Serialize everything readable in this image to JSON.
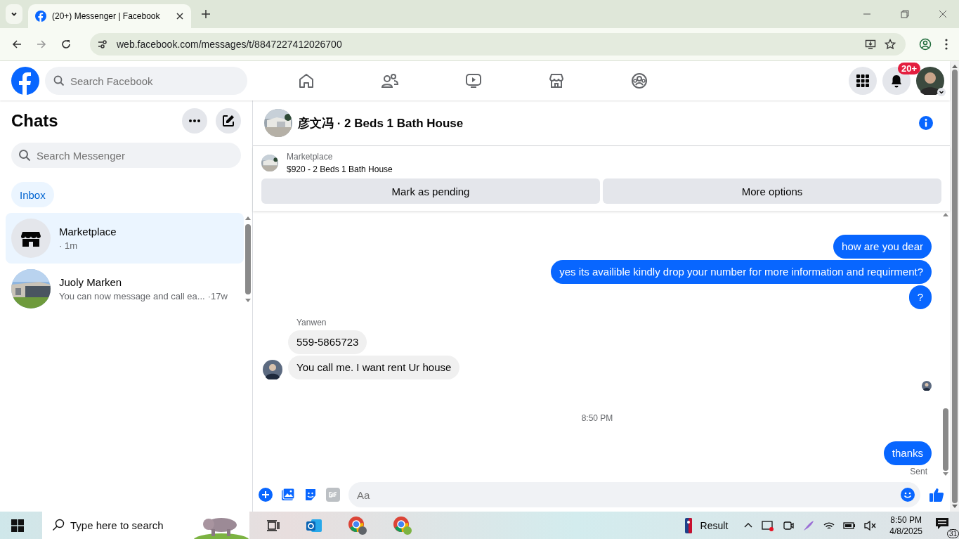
{
  "browser": {
    "tabs": [
      {
        "title": "(20+) Messenger | Facebook",
        "selected": true
      }
    ],
    "url": "web.facebook.com/messages/t/8847227412026700"
  },
  "topbar": {
    "search_placeholder": "Search Facebook",
    "notification_badge": "20+"
  },
  "sidebar": {
    "title": "Chats",
    "search_placeholder": "Search Messenger",
    "filters": [
      {
        "label": "Inbox",
        "selected": true
      }
    ],
    "chats": [
      {
        "kind": "store",
        "name": "Marketplace",
        "time": "· 1m",
        "selected": true
      },
      {
        "name": "Juoly Marken",
        "preview": "You can now message and call ea...",
        "time": "·17w",
        "selected": false
      }
    ]
  },
  "chat": {
    "title": "彦文冯 · 2 Beds 1 Bath House",
    "listing": {
      "label": "Marketplace",
      "text": "$920 - 2 Beds 1 Bath House"
    },
    "actions": [
      "Mark as pending",
      "More options"
    ],
    "messages": [
      {
        "kind": "outgoing",
        "text": "how are you dear"
      },
      {
        "kind": "outgoing",
        "text": "yes its availible kindly drop your number for more information and requirment?"
      },
      {
        "kind": "outgoing",
        "text": "?"
      },
      {
        "kind": "sender",
        "text": "Yanwen"
      },
      {
        "kind": "incoming",
        "text": "559-5865723",
        "avatar": false
      },
      {
        "kind": "incoming",
        "text": "You call me. I want rent Ur house",
        "avatar": true
      },
      {
        "kind": "seen"
      },
      {
        "kind": "time",
        "text": "8:50 PM"
      },
      {
        "kind": "outgoing",
        "text": "thanks"
      },
      {
        "kind": "status",
        "text": "Sent"
      }
    ],
    "composer_placeholder": "Aa"
  },
  "taskbar": {
    "search_placeholder": "Type here to search",
    "news": "Result",
    "time": "8:50 PM",
    "date": "4/8/2025",
    "notifications": "31"
  }
}
